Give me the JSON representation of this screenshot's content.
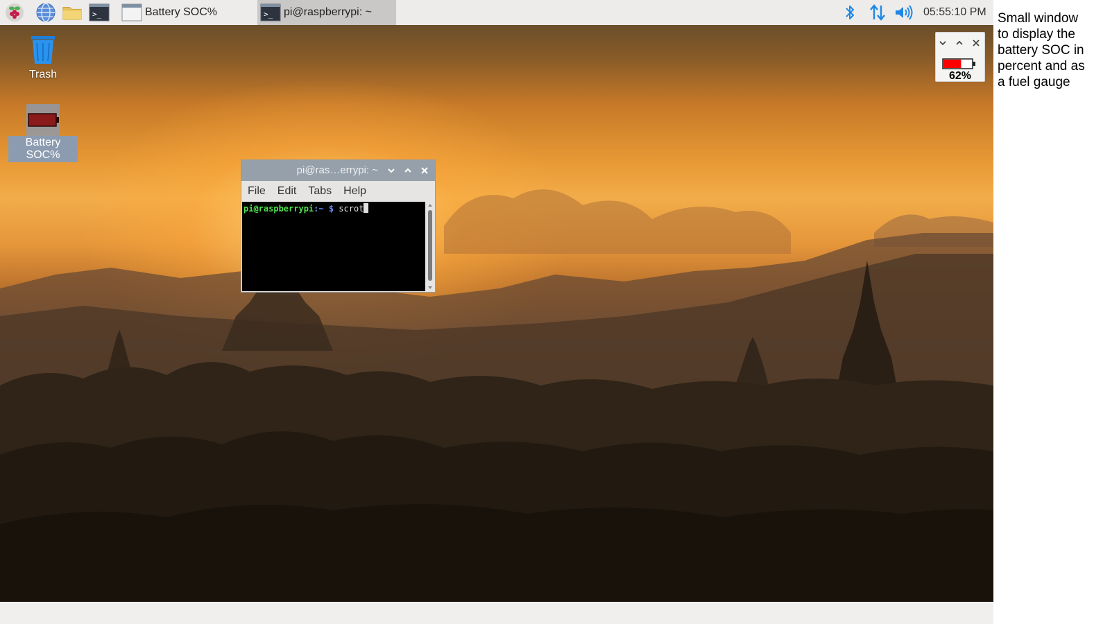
{
  "taskbar": {
    "tasks": [
      {
        "label": "Battery SOC%",
        "active": false
      },
      {
        "label": "pi@raspberrypi: ~",
        "active": true
      }
    ],
    "clock": "05:55:10 PM",
    "launchers": [
      "raspberry-menu-icon",
      "web-browser-icon",
      "file-manager-icon",
      "terminal-icon"
    ],
    "tray": [
      "bluetooth-icon",
      "network-icon",
      "volume-icon"
    ]
  },
  "desktop": {
    "icons": [
      {
        "label": "Trash",
        "icon": "trash-icon"
      },
      {
        "label": "Battery SOC%",
        "icon": "battery-icon"
      }
    ]
  },
  "terminal": {
    "title": "pi@ras…errypi: ~",
    "menu": [
      "File",
      "Edit",
      "Tabs",
      "Help"
    ],
    "prompt_user": "pi@raspberrypi",
    "prompt_path": ":~ $",
    "command": " scrot"
  },
  "battery_window": {
    "percent": "62%",
    "level": 0.62,
    "fill_color": "#ff0000"
  },
  "annotation": "Small window\nto display the\nbattery SOC in\npercent and as\na fuel gauge",
  "colors": {
    "prompt_green": "#4ee34e",
    "prompt_blue": "#6f8fff",
    "tray_blue": "#1e88e5"
  }
}
